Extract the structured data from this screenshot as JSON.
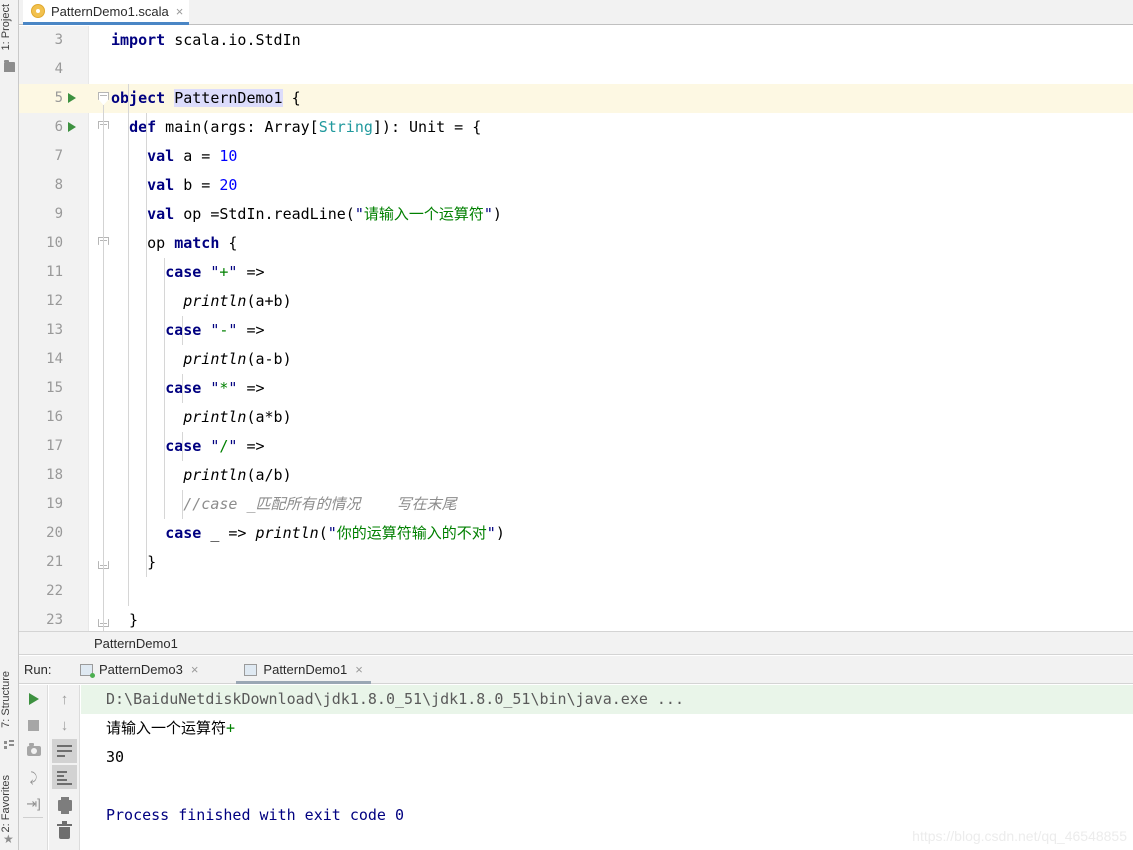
{
  "rail": {
    "project": "1: Project",
    "structure": "7: Structure",
    "favorites": "2: Favorites",
    "folder_icon": "folder-icon",
    "structure_icon": "structure-icon",
    "favorites_icon": "star-icon"
  },
  "editor_tab": {
    "filename": "PatternDemo1.scala",
    "close": "×",
    "file_icon": "scala-object-icon"
  },
  "code": {
    "lines": [
      {
        "num": "3",
        "run": false,
        "fold": null,
        "hl": false,
        "tokens": [
          {
            "t": "import",
            "c": "kw"
          },
          {
            "t": " scala.io.StdIn",
            "c": ""
          }
        ]
      },
      {
        "num": "4",
        "run": false,
        "fold": null,
        "hl": false,
        "tokens": []
      },
      {
        "num": "5",
        "run": true,
        "fold": "open",
        "hl": true,
        "tokens": [
          {
            "t": "object",
            "c": "kw"
          },
          {
            "t": " ",
            "c": ""
          },
          {
            "t": "PatternDemo1",
            "c": "id-hl"
          },
          {
            "t": " {",
            "c": ""
          }
        ]
      },
      {
        "num": "6",
        "run": true,
        "fold": "open",
        "hl": false,
        "tokens": [
          {
            "t": "  ",
            "c": ""
          },
          {
            "t": "def",
            "c": "kw"
          },
          {
            "t": " main(args: Array[",
            "c": ""
          },
          {
            "t": "String",
            "c": "typ"
          },
          {
            "t": "]): Unit = {",
            "c": ""
          }
        ]
      },
      {
        "num": "7",
        "run": false,
        "fold": null,
        "hl": false,
        "tokens": [
          {
            "t": "    ",
            "c": ""
          },
          {
            "t": "val",
            "c": "kw"
          },
          {
            "t": " a = ",
            "c": ""
          },
          {
            "t": "10",
            "c": "num"
          }
        ]
      },
      {
        "num": "8",
        "run": false,
        "fold": null,
        "hl": false,
        "tokens": [
          {
            "t": "    ",
            "c": ""
          },
          {
            "t": "val",
            "c": "kw"
          },
          {
            "t": " b = ",
            "c": ""
          },
          {
            "t": "20",
            "c": "num"
          }
        ]
      },
      {
        "num": "9",
        "run": false,
        "fold": null,
        "hl": false,
        "tokens": [
          {
            "t": "    ",
            "c": ""
          },
          {
            "t": "val",
            "c": "kw"
          },
          {
            "t": " op =StdIn.readLine(",
            "c": ""
          },
          {
            "t": "\"",
            "c": "qt"
          },
          {
            "t": "请输入一个运算符",
            "c": "str"
          },
          {
            "t": "\"",
            "c": "qt"
          },
          {
            "t": ")",
            "c": ""
          }
        ]
      },
      {
        "num": "10",
        "run": false,
        "fold": "open",
        "hl": false,
        "tokens": [
          {
            "t": "    op ",
            "c": ""
          },
          {
            "t": "match",
            "c": "kw"
          },
          {
            "t": " {",
            "c": ""
          }
        ]
      },
      {
        "num": "11",
        "run": false,
        "fold": null,
        "hl": false,
        "tokens": [
          {
            "t": "      ",
            "c": ""
          },
          {
            "t": "case",
            "c": "kw"
          },
          {
            "t": " ",
            "c": ""
          },
          {
            "t": "\"",
            "c": "qt"
          },
          {
            "t": "+",
            "c": "str"
          },
          {
            "t": "\"",
            "c": "qt"
          },
          {
            "t": " =>",
            "c": ""
          }
        ]
      },
      {
        "num": "12",
        "run": false,
        "fold": null,
        "hl": false,
        "tokens": [
          {
            "t": "        ",
            "c": ""
          },
          {
            "t": "println",
            "c": "fn"
          },
          {
            "t": "(a+b)",
            "c": ""
          }
        ]
      },
      {
        "num": "13",
        "run": false,
        "fold": null,
        "hl": false,
        "tokens": [
          {
            "t": "      ",
            "c": ""
          },
          {
            "t": "case",
            "c": "kw"
          },
          {
            "t": " ",
            "c": ""
          },
          {
            "t": "\"",
            "c": "qt"
          },
          {
            "t": "-",
            "c": "str"
          },
          {
            "t": "\"",
            "c": "qt"
          },
          {
            "t": " =>",
            "c": ""
          }
        ]
      },
      {
        "num": "14",
        "run": false,
        "fold": null,
        "hl": false,
        "tokens": [
          {
            "t": "        ",
            "c": ""
          },
          {
            "t": "println",
            "c": "fn"
          },
          {
            "t": "(a-b)",
            "c": ""
          }
        ]
      },
      {
        "num": "15",
        "run": false,
        "fold": null,
        "hl": false,
        "tokens": [
          {
            "t": "      ",
            "c": ""
          },
          {
            "t": "case",
            "c": "kw"
          },
          {
            "t": " ",
            "c": ""
          },
          {
            "t": "\"",
            "c": "qt"
          },
          {
            "t": "*",
            "c": "str"
          },
          {
            "t": "\"",
            "c": "qt"
          },
          {
            "t": " =>",
            "c": ""
          }
        ]
      },
      {
        "num": "16",
        "run": false,
        "fold": null,
        "hl": false,
        "tokens": [
          {
            "t": "        ",
            "c": ""
          },
          {
            "t": "println",
            "c": "fn"
          },
          {
            "t": "(a*b)",
            "c": ""
          }
        ]
      },
      {
        "num": "17",
        "run": false,
        "fold": null,
        "hl": false,
        "tokens": [
          {
            "t": "      ",
            "c": ""
          },
          {
            "t": "case",
            "c": "kw"
          },
          {
            "t": " ",
            "c": ""
          },
          {
            "t": "\"",
            "c": "qt"
          },
          {
            "t": "/",
            "c": "str"
          },
          {
            "t": "\"",
            "c": "qt"
          },
          {
            "t": " =>",
            "c": ""
          }
        ]
      },
      {
        "num": "18",
        "run": false,
        "fold": null,
        "hl": false,
        "tokens": [
          {
            "t": "        ",
            "c": ""
          },
          {
            "t": "println",
            "c": "fn"
          },
          {
            "t": "(a/b)",
            "c": ""
          }
        ]
      },
      {
        "num": "19",
        "run": false,
        "fold": null,
        "hl": false,
        "tokens": [
          {
            "t": "        ",
            "c": ""
          },
          {
            "t": "//case _匹配所有的情况    写在末尾",
            "c": "cm"
          }
        ]
      },
      {
        "num": "20",
        "run": false,
        "fold": null,
        "hl": false,
        "tokens": [
          {
            "t": "      ",
            "c": ""
          },
          {
            "t": "case",
            "c": "kw"
          },
          {
            "t": " _ => ",
            "c": ""
          },
          {
            "t": "println",
            "c": "fn"
          },
          {
            "t": "(",
            "c": ""
          },
          {
            "t": "\"",
            "c": "qt"
          },
          {
            "t": "你的运算符输入的不对",
            "c": "str"
          },
          {
            "t": "\"",
            "c": "qt"
          },
          {
            "t": ")",
            "c": ""
          }
        ]
      },
      {
        "num": "21",
        "run": false,
        "fold": "close",
        "hl": false,
        "tokens": [
          {
            "t": "    }",
            "c": ""
          }
        ]
      },
      {
        "num": "22",
        "run": false,
        "fold": null,
        "hl": false,
        "tokens": []
      },
      {
        "num": "23",
        "run": false,
        "fold": "close",
        "hl": false,
        "tokens": [
          {
            "t": "  }",
            "c": ""
          }
        ]
      }
    ]
  },
  "breadcrumb": {
    "path": "PatternDemo1"
  },
  "run_panel": {
    "label": "Run:",
    "tabs": [
      {
        "name": "PatternDemo3",
        "active": false,
        "running": true,
        "close": "×"
      },
      {
        "name": "PatternDemo1",
        "active": true,
        "running": false,
        "close": "×"
      }
    ],
    "toolbar_left": [
      {
        "name": "rerun-button",
        "icon": "play-icon"
      },
      {
        "name": "stop-button",
        "icon": "stop-icon"
      },
      {
        "name": "screenshot-button",
        "icon": "camera-icon"
      },
      {
        "name": "thread-dump-button",
        "icon": "thread-dump-icon"
      },
      {
        "name": "restore-layout-button",
        "icon": "restore-icon"
      }
    ],
    "toolbar_right": [
      {
        "name": "up-button",
        "icon": "arrow-up-icon",
        "selected": false
      },
      {
        "name": "down-button",
        "icon": "arrow-down-icon",
        "selected": false
      },
      {
        "name": "soft-wrap-button",
        "icon": "wrap-icon",
        "selected": true
      },
      {
        "name": "scroll-end-button",
        "icon": "scroll-end-icon",
        "selected": true
      },
      {
        "name": "print-button",
        "icon": "printer-icon",
        "selected": false
      },
      {
        "name": "clear-all-button",
        "icon": "trash-icon",
        "selected": false
      }
    ],
    "console": [
      {
        "text": "D:\\BaiduNetdiskDownload\\jdk1.8.0_51\\jdk1.8.0_51\\bin\\java.exe ...",
        "cls": "c-cmd"
      },
      {
        "text": "请输入一个运算符",
        "suffix": "+",
        "cls": "c-out"
      },
      {
        "text": "30",
        "cls": "c-out"
      },
      {
        "text": "",
        "cls": "c-out"
      },
      {
        "text": "Process finished with exit code 0",
        "cls": "c-fin"
      }
    ]
  },
  "watermark": {
    "text": "https://blog.csdn.net/qq_46548855"
  }
}
